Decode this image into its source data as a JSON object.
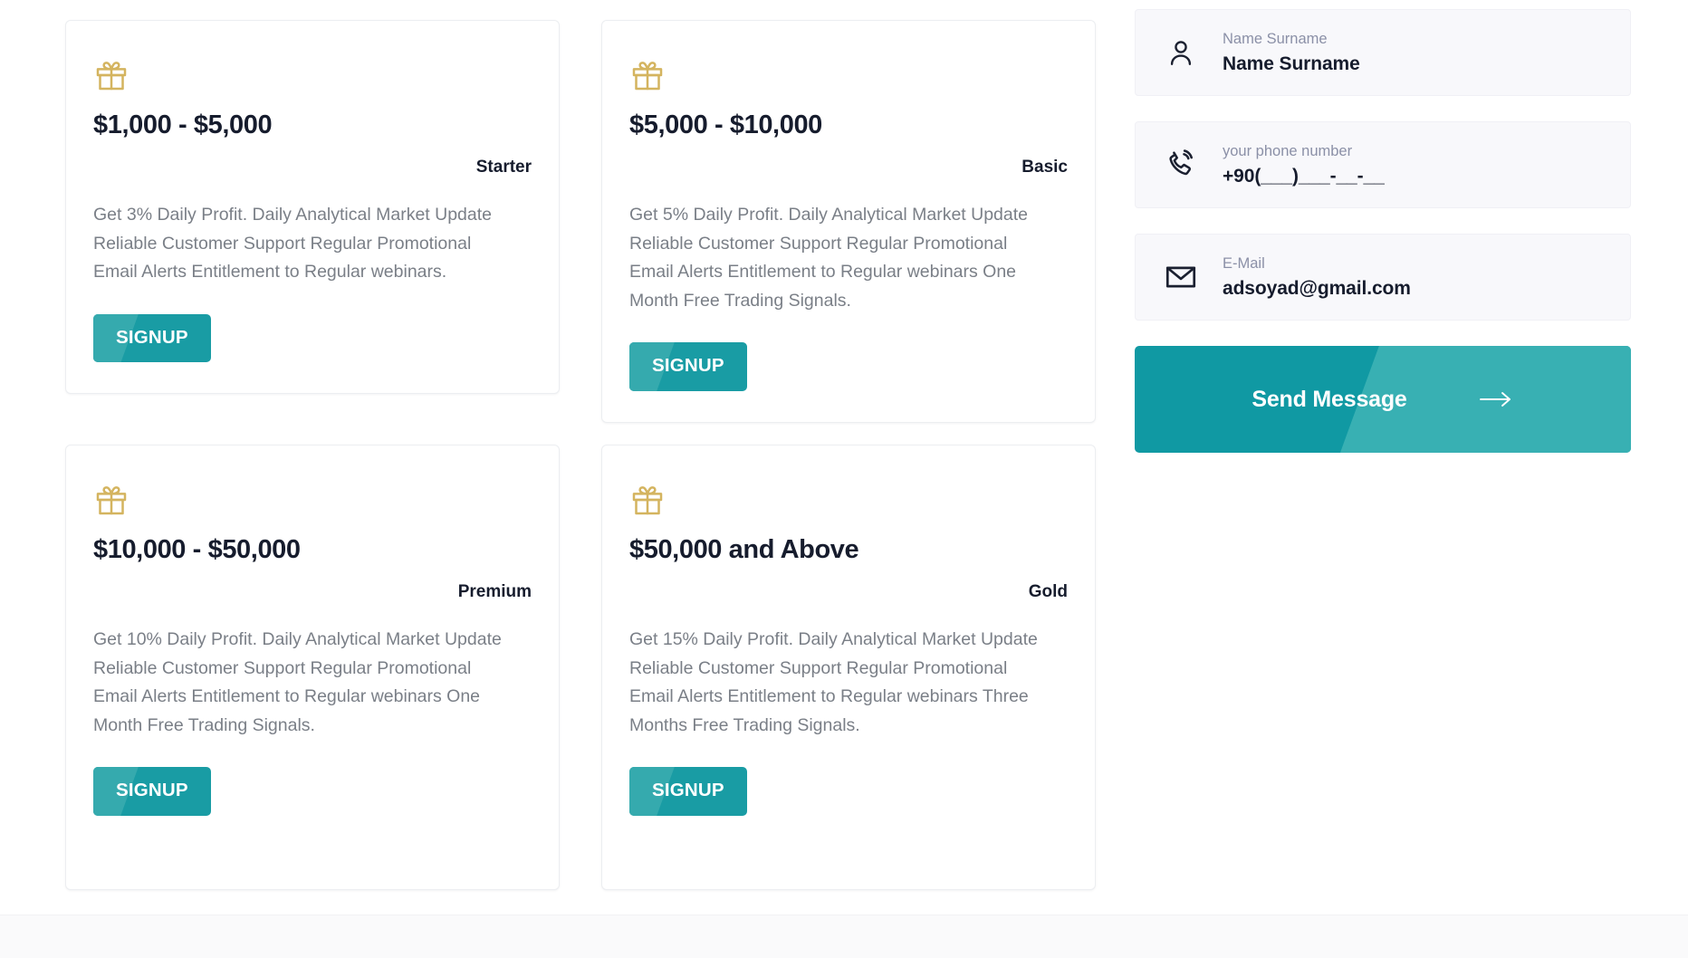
{
  "plans": [
    {
      "icon": "gift-icon",
      "price": "$1,000 - $5,000",
      "tier": "Starter",
      "description": "Get 3% Daily Profit. Daily Analytical Market Update Reliable Customer Support Regular Promotional Email Alerts Entitlement to Regular webinars.",
      "button_label": "SIGNUP"
    },
    {
      "icon": "gift-icon",
      "price": "$5,000 - $10,000",
      "tier": "Basic",
      "description": "Get 5% Daily Profit. Daily Analytical Market Update Reliable Customer Support Regular Promotional Email Alerts Entitlement to Regular webinars One Month Free Trading Signals.",
      "button_label": "SIGNUP"
    },
    {
      "icon": "gift-icon",
      "price": "$10,000 - $50,000",
      "tier": "Premium",
      "description": "Get 10% Daily Profit. Daily Analytical Market Update Reliable Customer Support Regular Promotional Email Alerts Entitlement to Regular webinars One Month Free Trading Signals.",
      "button_label": "SIGNUP"
    },
    {
      "icon": "gift-icon",
      "price": "$50,000 and Above",
      "tier": "Gold",
      "description": "Get 15% Daily Profit. Daily Analytical Market Update Reliable Customer Support Regular Promotional Email Alerts Entitlement to Regular webinars Three Months Free Trading Signals.",
      "button_label": "SIGNUP"
    }
  ],
  "contact_form": {
    "name_field": {
      "icon": "user-icon",
      "label": "Name Surname",
      "value": "Name Surname",
      "placeholder": "Name Surname"
    },
    "phone_field": {
      "icon": "phone-icon",
      "label": "your phone number",
      "value": "+90(___)___-__-__",
      "placeholder": "+90(___)___-__-__"
    },
    "email_field": {
      "icon": "envelope-icon",
      "label": "E-Mail",
      "value": "adsoyad@gmail.com",
      "placeholder": "E-Mail"
    },
    "submit": {
      "label": "Send Message",
      "icon": "arrow-right-icon"
    }
  },
  "colors": {
    "accent_teal": "#1099a3",
    "accent_teal_light": "#38b0b3",
    "signup_teal": "#199ca4",
    "signup_teal_light": "#35aaae",
    "gift_gold": "#d4b45f",
    "heading_dark": "#161c2d",
    "body_gray": "#7a7f87",
    "label_gray": "#8b90a7",
    "field_bg": "#f8f8fb",
    "card_border": "#eceef1",
    "page_bg": "#ffffff",
    "footer_bg": "#fafafb"
  }
}
